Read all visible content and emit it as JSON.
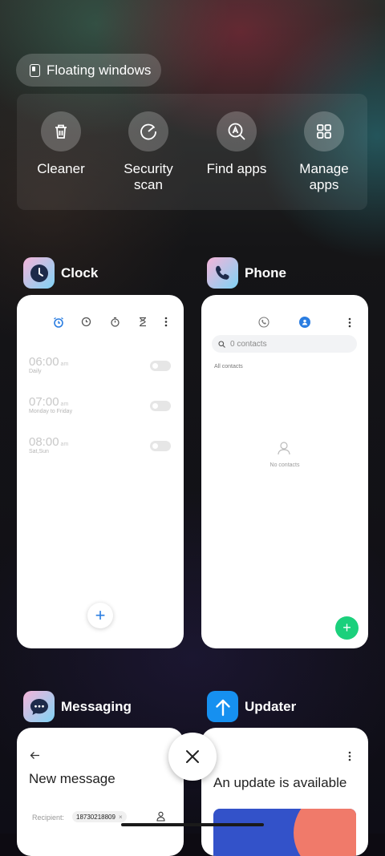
{
  "floating_windows": {
    "label": "Floating windows"
  },
  "tools": [
    {
      "label_line1": "Cleaner",
      "label_line2": "",
      "icon": "trash-icon"
    },
    {
      "label_line1": "Security",
      "label_line2": "scan",
      "icon": "security-scan-icon"
    },
    {
      "label_line1": "Find apps",
      "label_line2": "",
      "icon": "find-apps-icon"
    },
    {
      "label_line1": "Manage",
      "label_line2": "apps",
      "icon": "grid-icon"
    }
  ],
  "clock": {
    "title": "Clock",
    "alarms": [
      {
        "time": "06:00",
        "ampm": "am",
        "repeat": "Daily"
      },
      {
        "time": "07:00",
        "ampm": "am",
        "repeat": "Monday to Friday"
      },
      {
        "time": "08:00",
        "ampm": "am",
        "repeat": "Sat,Sun"
      }
    ],
    "add_symbol": "+"
  },
  "phone": {
    "title": "Phone",
    "search_placeholder": "0 contacts",
    "section": "All contacts",
    "empty": "No contacts",
    "add_symbol": "+"
  },
  "messaging": {
    "title": "Messaging",
    "heading": "New message",
    "recipient_label": "Recipient:",
    "recipient_chip": "18730218809",
    "chip_remove": "×"
  },
  "updater": {
    "title": "Updater",
    "heading": "An update is available"
  },
  "colors": {
    "accent_blue": "#2a7de1",
    "phone_green": "#1bd07c",
    "updater_blue": "#1690f0"
  }
}
